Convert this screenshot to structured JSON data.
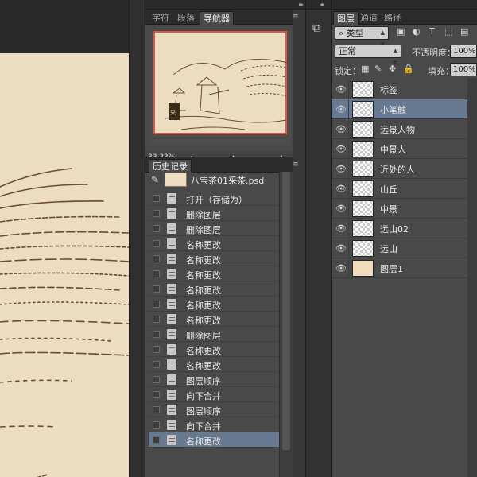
{
  "navigator": {
    "tabs": [
      "字符",
      "段落",
      "导航器"
    ],
    "zoom": "33.33%"
  },
  "history": {
    "tab": "历史记录",
    "snapshot_name": "八宝茶01采茶.psd",
    "items": [
      {
        "label": "打开（存储为）"
      },
      {
        "label": "删除图层"
      },
      {
        "label": "删除图层"
      },
      {
        "label": "名称更改"
      },
      {
        "label": "名称更改"
      },
      {
        "label": "名称更改"
      },
      {
        "label": "名称更改"
      },
      {
        "label": "名称更改"
      },
      {
        "label": "名称更改"
      },
      {
        "label": "删除图层"
      },
      {
        "label": "名称更改"
      },
      {
        "label": "名称更改"
      },
      {
        "label": "图层顺序"
      },
      {
        "label": "向下合并"
      },
      {
        "label": "图层顺序"
      },
      {
        "label": "向下合并"
      },
      {
        "label": "名称更改",
        "selected": true
      }
    ]
  },
  "layers": {
    "tabs": [
      "图层",
      "通道",
      "路径"
    ],
    "filter_type": "类型",
    "blend_mode": "正常",
    "opacity_label": "不透明度：",
    "opacity_value": "100%",
    "lock_label": "锁定：",
    "fill_label": "填充：",
    "fill_value": "100%",
    "items": [
      {
        "name": "标签"
      },
      {
        "name": "小笔触",
        "selected": true
      },
      {
        "name": "远景人物"
      },
      {
        "name": "中景人"
      },
      {
        "name": "近处的人"
      },
      {
        "name": "山丘"
      },
      {
        "name": "中景"
      },
      {
        "name": "远山02"
      },
      {
        "name": "远山"
      },
      {
        "name": "图层1",
        "solid": true
      }
    ]
  },
  "colors": {
    "selection": "#677891",
    "canvas_bg": "#ecdcc0",
    "navigator_frame": "#e0534a",
    "ink": "#6b4e2e"
  }
}
